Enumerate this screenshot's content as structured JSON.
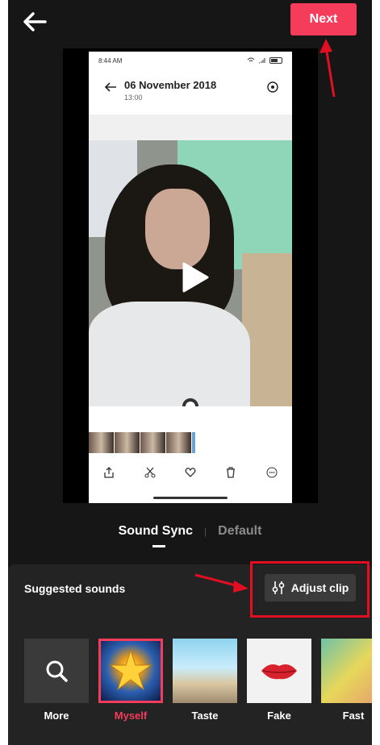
{
  "top_bar": {
    "next_label": "Next"
  },
  "gallery": {
    "status_time": "8:44 AM",
    "date": "06 November 2018",
    "time": "13:00"
  },
  "tabs": {
    "active": "Sound Sync",
    "inactive": "Default"
  },
  "sheet": {
    "suggested_label": "Suggested sounds",
    "adjust_label": "Adjust clip"
  },
  "sounds": [
    {
      "label": "More"
    },
    {
      "label": "Myself"
    },
    {
      "label": "Taste"
    },
    {
      "label": "Fake"
    },
    {
      "label": "Fast"
    }
  ],
  "colors": {
    "accent": "#f53c5a",
    "annotation": "#e20f23",
    "background": "#161616"
  }
}
